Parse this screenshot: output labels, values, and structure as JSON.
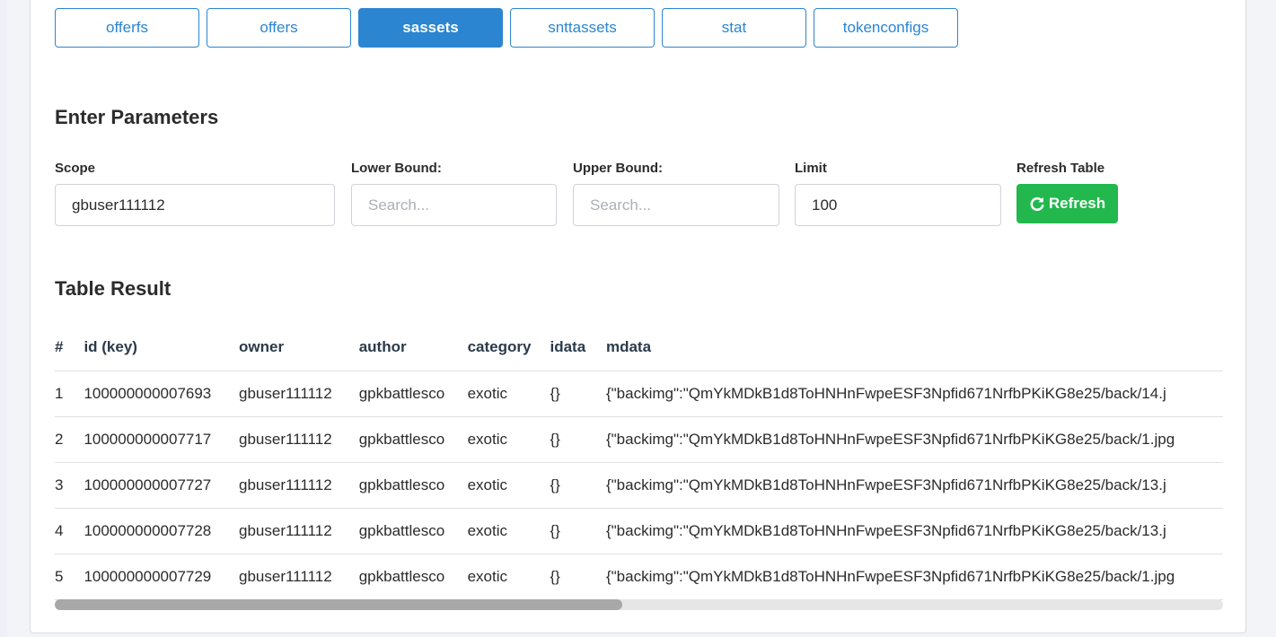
{
  "tabs": [
    {
      "label": "offerfs",
      "active": false
    },
    {
      "label": "offers",
      "active": false
    },
    {
      "label": "sassets",
      "active": true
    },
    {
      "label": "snttassets",
      "active": false
    },
    {
      "label": "stat",
      "active": false
    },
    {
      "label": "tokenconfigs",
      "active": false
    }
  ],
  "params": {
    "title": "Enter Parameters",
    "scope": {
      "label": "Scope",
      "value": "gbuser111112"
    },
    "lower_bound": {
      "label": "Lower Bound:",
      "placeholder": "Search..."
    },
    "upper_bound": {
      "label": "Upper Bound:",
      "placeholder": "Search..."
    },
    "limit": {
      "label": "Limit",
      "value": "100"
    },
    "refresh": {
      "label": "Refresh Table",
      "button": "Refresh"
    }
  },
  "result": {
    "title": "Table Result",
    "columns": [
      "#",
      "id (key)",
      "owner",
      "author",
      "category",
      "idata",
      "mdata"
    ],
    "rows": [
      [
        "1",
        "100000000007693",
        "gbuser111112",
        "gpkbattlesco",
        "exotic",
        "{}",
        "{\"backimg\":\"QmYkMDkB1d8ToHNHnFwpeESF3Npfid671NrfbPKiKG8e25/back/14.j"
      ],
      [
        "2",
        "100000000007717",
        "gbuser111112",
        "gpkbattlesco",
        "exotic",
        "{}",
        "{\"backimg\":\"QmYkMDkB1d8ToHNHnFwpeESF3Npfid671NrfbPKiKG8e25/back/1.jpg"
      ],
      [
        "3",
        "100000000007727",
        "gbuser111112",
        "gpkbattlesco",
        "exotic",
        "{}",
        "{\"backimg\":\"QmYkMDkB1d8ToHNHnFwpeESF3Npfid671NrfbPKiKG8e25/back/13.j"
      ],
      [
        "4",
        "100000000007728",
        "gbuser111112",
        "gpkbattlesco",
        "exotic",
        "{}",
        "{\"backimg\":\"QmYkMDkB1d8ToHNHnFwpeESF3Npfid671NrfbPKiKG8e25/back/13.j"
      ],
      [
        "5",
        "100000000007729",
        "gbuser111112",
        "gpkbattlesco",
        "exotic",
        "{}",
        "{\"backimg\":\"QmYkMDkB1d8ToHNHnFwpeESF3Npfid671NrfbPKiKG8e25/back/1.jpg"
      ]
    ]
  },
  "colors": {
    "primary": "#2b85d1",
    "success": "#22b84d"
  },
  "icons": {
    "refresh": "refresh-icon"
  }
}
